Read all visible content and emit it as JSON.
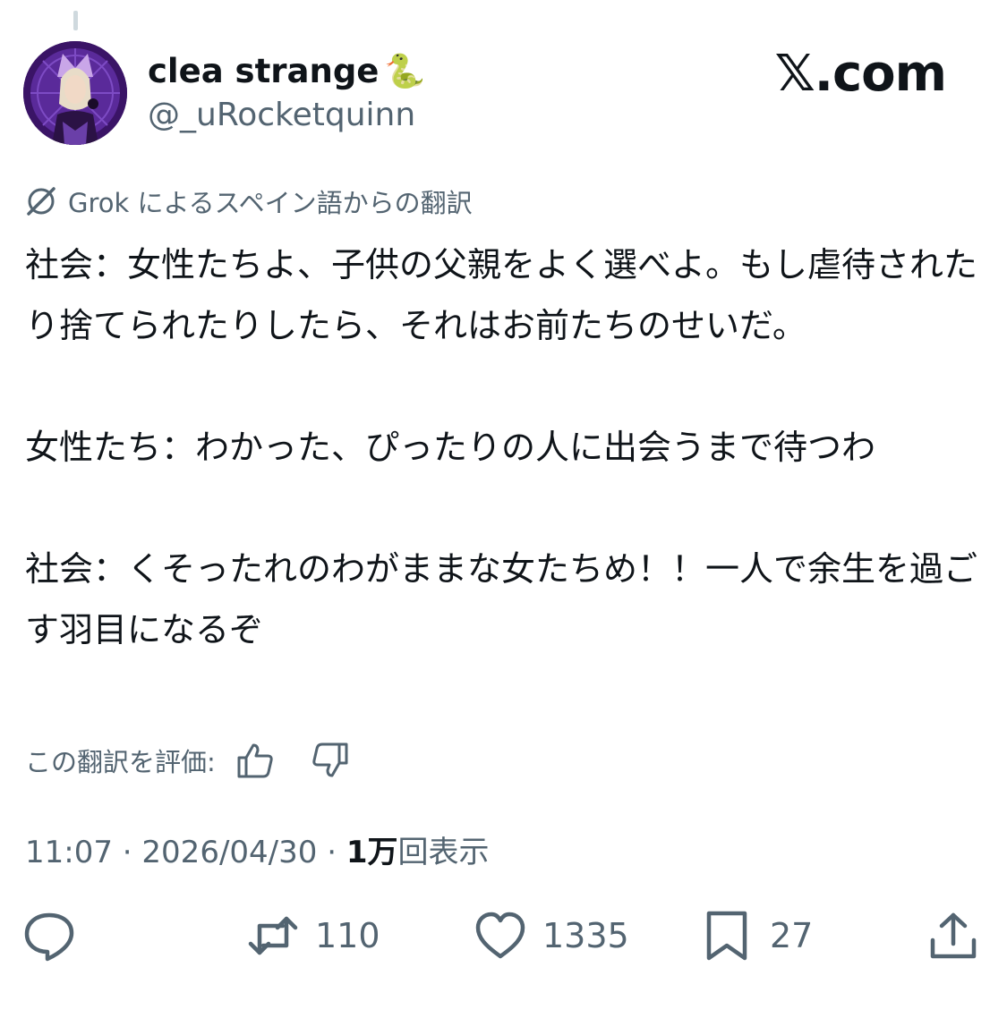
{
  "brand": "𝕏.com",
  "author": {
    "display_name": "clea strange",
    "emoji": "🐍",
    "handle": "@_uRocketquinn"
  },
  "translation": {
    "note": "Grok によるスペイン語からの翻訳",
    "rate_label": "この翻訳を評価:"
  },
  "tweet": {
    "paragraphs": [
      "社会：女性たちよ、子供の父親をよく選べよ。もし虐待されたり捨てられたりしたら、それはお前たちのせいだ。",
      "女性たち：わかった、ぴったりの人に出会うまで待つわ",
      "社会：くそったれのわがままな女たちめ！！一人で余生を過ごす羽目になるぞ"
    ]
  },
  "meta": {
    "time": "11:07",
    "sep1": " · ",
    "date": "2026/04/30",
    "sep2": " · ",
    "views_count": "1万",
    "views_label": "回表示"
  },
  "actions": {
    "reply_icon": "reply-bubble-icon",
    "retweet_count": "110",
    "like_count": "1335",
    "bookmark_count": "27",
    "share_icon": "share-upload-icon"
  },
  "colors": {
    "text": "#0f1419",
    "secondary": "#536471",
    "avatar_bg": "#3a1466",
    "thread_line": "#cfd9de"
  }
}
